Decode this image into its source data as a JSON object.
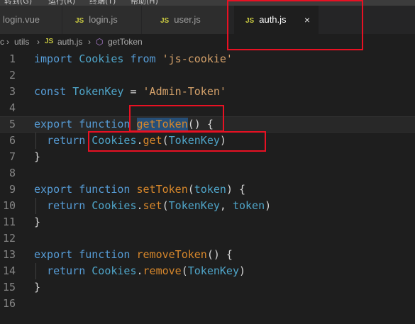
{
  "menubar": {
    "items": [
      "转到(G)",
      "运行(R)",
      "终端(T)",
      "帮助(H)"
    ]
  },
  "tabs": [
    {
      "icon": "vue-file-icon",
      "label": "login.vue",
      "active": false
    },
    {
      "icon": "js-file-icon",
      "prefix": "JS",
      "label": "login.js",
      "active": false
    },
    {
      "icon": "js-file-icon",
      "prefix": "JS",
      "label": "user.js",
      "active": false
    },
    {
      "icon": "js-file-icon",
      "prefix": "JS",
      "label": "auth.js",
      "active": true,
      "close": "×"
    }
  ],
  "breadcrumb": {
    "lead": "c",
    "sep": "›",
    "folder": "utils",
    "file_prefix": "JS",
    "file": "auth.js",
    "symbol": "getToken"
  },
  "editor": {
    "line_numbers": [
      "1",
      "2",
      "3",
      "4",
      "5",
      "6",
      "7",
      "8",
      "9",
      "10",
      "11",
      "12",
      "13",
      "14",
      "15",
      "16"
    ],
    "lines": [
      {
        "t": [
          [
            "kw",
            "import"
          ],
          [
            "pn",
            " "
          ],
          [
            "id",
            "Cookies"
          ],
          [
            "pn",
            " "
          ],
          [
            "kw",
            "from"
          ],
          [
            "pn",
            " "
          ],
          [
            "str",
            "'js-cookie'"
          ]
        ]
      },
      {
        "t": []
      },
      {
        "t": [
          [
            "kw",
            "const"
          ],
          [
            "pn",
            " "
          ],
          [
            "id",
            "TokenKey"
          ],
          [
            "pn",
            " "
          ],
          [
            "op",
            "="
          ],
          [
            "pn",
            " "
          ],
          [
            "str",
            "'Admin-Token'"
          ]
        ]
      },
      {
        "t": []
      },
      {
        "t": [
          [
            "kw",
            "export"
          ],
          [
            "pn",
            " "
          ],
          [
            "kw",
            "function"
          ],
          [
            "pn",
            " "
          ],
          [
            "fn",
            "getToken",
            "sel"
          ],
          [
            "pn",
            "() {"
          ]
        ],
        "current": true
      },
      {
        "t": [
          [
            "pn",
            "  "
          ],
          [
            "kw",
            "return"
          ],
          [
            "pn",
            " "
          ],
          [
            "id",
            "Cookies"
          ],
          [
            "pn",
            "."
          ],
          [
            "fn",
            "get"
          ],
          [
            "pn",
            "("
          ],
          [
            "id",
            "TokenKey"
          ],
          [
            "pn",
            ")"
          ]
        ]
      },
      {
        "t": [
          [
            "pn",
            "}"
          ]
        ]
      },
      {
        "t": []
      },
      {
        "t": [
          [
            "kw",
            "export"
          ],
          [
            "pn",
            " "
          ],
          [
            "kw",
            "function"
          ],
          [
            "pn",
            " "
          ],
          [
            "fn",
            "setToken"
          ],
          [
            "pn",
            "("
          ],
          [
            "id",
            "token"
          ],
          [
            "pn",
            ") {"
          ]
        ]
      },
      {
        "t": [
          [
            "pn",
            "  "
          ],
          [
            "kw",
            "return"
          ],
          [
            "pn",
            " "
          ],
          [
            "id",
            "Cookies"
          ],
          [
            "pn",
            "."
          ],
          [
            "fn",
            "set"
          ],
          [
            "pn",
            "("
          ],
          [
            "id",
            "TokenKey"
          ],
          [
            "pn",
            ", "
          ],
          [
            "id",
            "token"
          ],
          [
            "pn",
            ")"
          ]
        ]
      },
      {
        "t": [
          [
            "pn",
            "}"
          ]
        ]
      },
      {
        "t": []
      },
      {
        "t": [
          [
            "kw",
            "export"
          ],
          [
            "pn",
            " "
          ],
          [
            "kw",
            "function"
          ],
          [
            "pn",
            " "
          ],
          [
            "fn",
            "removeToken"
          ],
          [
            "pn",
            "() {"
          ]
        ]
      },
      {
        "t": [
          [
            "pn",
            "  "
          ],
          [
            "kw",
            "return"
          ],
          [
            "pn",
            " "
          ],
          [
            "id",
            "Cookies"
          ],
          [
            "pn",
            "."
          ],
          [
            "fn",
            "remove"
          ],
          [
            "pn",
            "("
          ],
          [
            "id",
            "TokenKey"
          ],
          [
            "pn",
            ")"
          ]
        ]
      },
      {
        "t": [
          [
            "pn",
            "}"
          ]
        ]
      },
      {
        "t": []
      }
    ]
  },
  "colors": {
    "keyword": "#569cd6",
    "function": "#d7872b",
    "identifier": "#4fa5c9",
    "string": "#d4a16a",
    "annotation_box": "#e81123"
  }
}
